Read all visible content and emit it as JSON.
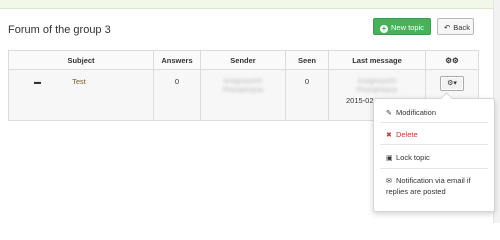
{
  "page": {
    "title": "Forum of the group 3"
  },
  "toolbar": {
    "new_topic_label": "New topic",
    "back_label": "Back"
  },
  "table": {
    "headers": [
      "Subject",
      "Answers",
      "Sender",
      "Seen",
      "Last message",
      ""
    ],
    "row": {
      "topic": "Test",
      "answers": "0",
      "sender_line1": "knagooyorhl",
      "sender_line2": "Phoniphoyoo",
      "seen": "0",
      "last_line1": "knagooyorhl",
      "last_line2": "Phoniphoyoo",
      "last_date": "2015-02"
    }
  },
  "menu": {
    "modification": "Modification",
    "delete": "Delete",
    "lock": "Lock topic",
    "notification": "Notification via email if replies are posted"
  },
  "colors": {
    "new_topic": "#49b15a",
    "delete": "#c0392b",
    "topic_link": "#7a5a2e"
  },
  "icons": [
    "plus-icon",
    "back-arrow-icon",
    "gears-icon",
    "comment-icon",
    "gear-icon",
    "edit-icon",
    "delete-icon",
    "lock-icon",
    "envelope-icon"
  ]
}
